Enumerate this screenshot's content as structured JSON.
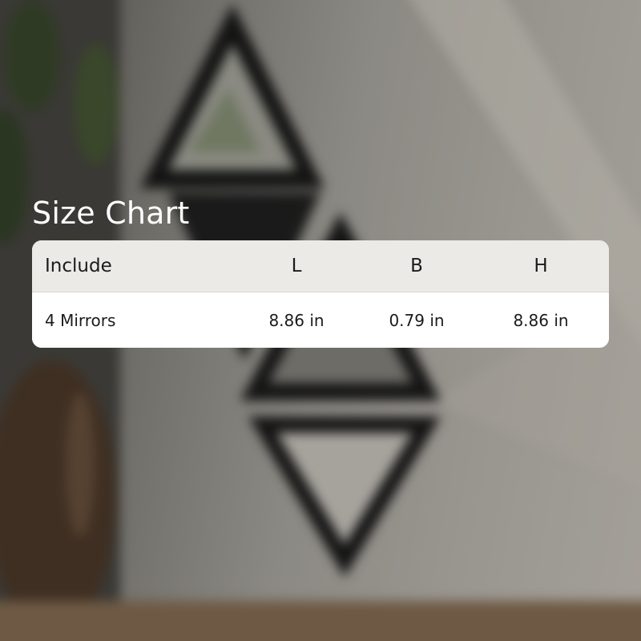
{
  "title": "Size Chart",
  "table": {
    "headers": [
      "Include",
      "L",
      "B",
      "H"
    ],
    "rows": [
      [
        "4 Mirrors",
        "8.86 in",
        "0.79 in",
        "8.86 in"
      ]
    ]
  }
}
